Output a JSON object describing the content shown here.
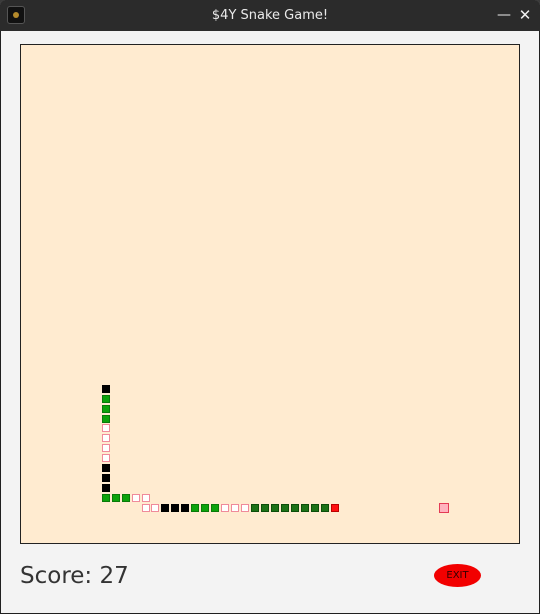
{
  "window": {
    "title": "$4Y Snake Game!"
  },
  "controls": {
    "minimize": "—",
    "close": "✕"
  },
  "game": {
    "grid": {
      "columns": 50,
      "rows": 50
    },
    "snake": [
      {
        "col": 8,
        "row": 34,
        "type": "black"
      },
      {
        "col": 8,
        "row": 35,
        "type": "green"
      },
      {
        "col": 8,
        "row": 36,
        "type": "green"
      },
      {
        "col": 8,
        "row": 37,
        "type": "green"
      },
      {
        "col": 8,
        "row": 38,
        "type": "empty"
      },
      {
        "col": 8,
        "row": 39,
        "type": "empty"
      },
      {
        "col": 8,
        "row": 40,
        "type": "empty"
      },
      {
        "col": 8,
        "row": 41,
        "type": "empty"
      },
      {
        "col": 8,
        "row": 42,
        "type": "black"
      },
      {
        "col": 8,
        "row": 43,
        "type": "black"
      },
      {
        "col": 8,
        "row": 44,
        "type": "black"
      },
      {
        "col": 8,
        "row": 45,
        "type": "green"
      },
      {
        "col": 9,
        "row": 45,
        "type": "green"
      },
      {
        "col": 10,
        "row": 45,
        "type": "green"
      },
      {
        "col": 11,
        "row": 45,
        "type": "empty"
      },
      {
        "col": 12,
        "row": 45,
        "type": "empty"
      },
      {
        "col": 12,
        "row": 46,
        "type": "empty"
      },
      {
        "col": 13,
        "row": 46,
        "type": "empty"
      },
      {
        "col": 14,
        "row": 46,
        "type": "black"
      },
      {
        "col": 15,
        "row": 46,
        "type": "black"
      },
      {
        "col": 16,
        "row": 46,
        "type": "black"
      },
      {
        "col": 17,
        "row": 46,
        "type": "green"
      },
      {
        "col": 18,
        "row": 46,
        "type": "green"
      },
      {
        "col": 19,
        "row": 46,
        "type": "green"
      },
      {
        "col": 20,
        "row": 46,
        "type": "empty"
      },
      {
        "col": 21,
        "row": 46,
        "type": "empty"
      },
      {
        "col": 22,
        "row": 46,
        "type": "empty"
      },
      {
        "col": 23,
        "row": 46,
        "type": "darkgreen"
      },
      {
        "col": 24,
        "row": 46,
        "type": "darkgreen"
      },
      {
        "col": 25,
        "row": 46,
        "type": "darkgreen"
      },
      {
        "col": 26,
        "row": 46,
        "type": "darkgreen"
      },
      {
        "col": 27,
        "row": 46,
        "type": "darkgreen"
      },
      {
        "col": 28,
        "row": 46,
        "type": "darkgreen"
      },
      {
        "col": 29,
        "row": 46,
        "type": "darkgreen"
      },
      {
        "col": 30,
        "row": 46,
        "type": "darkgreen"
      },
      {
        "col": 31,
        "row": 46,
        "type": "head"
      }
    ],
    "food": {
      "col": 42,
      "row": 46
    }
  },
  "score": {
    "label": "Score: 27"
  },
  "exit": {
    "label": "EXIT"
  }
}
